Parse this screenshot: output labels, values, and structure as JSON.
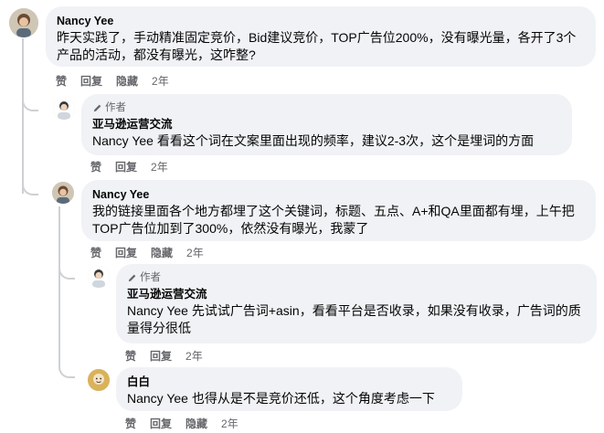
{
  "comments": [
    {
      "name": "Nancy Yee",
      "text": "昨天实践了，手动精准固定竞价，Bid建议竞价，TOP广告位200%，没有曝光量，各开了3个产品的活动，都没有曝光，这咋整?",
      "actions": {
        "like": "赞",
        "reply": "回复",
        "hide": "隐藏",
        "time": "2年"
      }
    },
    {
      "badge": "作者",
      "name": "亚马逊运营交流",
      "text": "Nancy Yee 看看这个词在文案里面出现的频率，建议2-3次，这个是埋词的方面",
      "actions": {
        "like": "赞",
        "reply": "回复",
        "time": "2年"
      }
    },
    {
      "name": "Nancy Yee",
      "text": "我的链接里面各个地方都埋了这个关键词，标题、五点、A+和QA里面都有埋，上午把TOP广告位加到了300%，依然没有曝光，我蒙了",
      "actions": {
        "like": "赞",
        "reply": "回复",
        "hide": "隐藏",
        "time": "2年"
      }
    },
    {
      "badge": "作者",
      "name": "亚马逊运营交流",
      "text": "Nancy Yee 先试试广告词+asin，看看平台是否收录，如果没有收录，广告词的质量得分很低",
      "actions": {
        "like": "赞",
        "reply": "回复",
        "time": "2年"
      }
    },
    {
      "name": "白白",
      "text": "Nancy Yee 也得从是不是竞价还低，这个角度考虑一下",
      "actions": {
        "like": "赞",
        "reply": "回复",
        "hide": "隐藏",
        "time": "2年"
      }
    }
  ],
  "colors": {
    "bubble": "#f0f2f5",
    "thread": "#ced0d4",
    "meta": "#65676b"
  }
}
